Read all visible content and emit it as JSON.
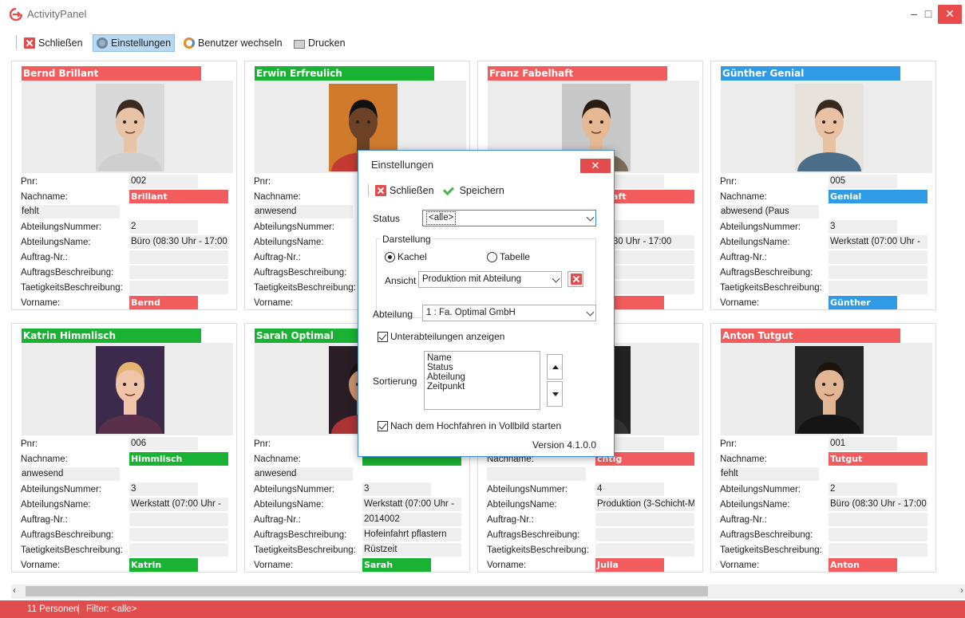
{
  "window": {
    "title": "ActivityPanel"
  },
  "toolbar": {
    "items": [
      {
        "label": "Schließen",
        "icon": "close-icon"
      },
      {
        "label": "Einstellungen",
        "icon": "gear-icon"
      },
      {
        "label": "Benutzer wechseln",
        "icon": "user-switch-icon"
      },
      {
        "label": "Drucken",
        "icon": "printer-icon"
      }
    ]
  },
  "field_labels": {
    "pnr": "Pnr:",
    "nachname": "Nachname:",
    "abt_nr": "AbteilungsNummer:",
    "abt_name": "AbteilungsName:",
    "auftrag": "Auftrag-Nr.:",
    "auftrag_beschr": "AuftragsBeschreibung:",
    "taetigkeit": "TaetigkeitsBeschreibung:",
    "vorname": "Vorname:"
  },
  "colors": {
    "red": "#f25c5c",
    "green": "#19b233",
    "blue": "#2f9be6"
  },
  "cards": [
    {
      "name": "Bernd Brillant",
      "color": "red",
      "pnr": "002",
      "nachname": "Brillant",
      "status": "fehlt",
      "abt_nr": "2",
      "abt_name": "Büro (08:30 Uhr - 17:00",
      "auftrag": "",
      "auftrag_beschr": "",
      "taetigkeit": "",
      "vorname": "Bernd"
    },
    {
      "name": "Erwin Erfreulich",
      "color": "green",
      "pnr": "",
      "nachname": "",
      "status": "anwesend",
      "abt_nr": "",
      "abt_name": "",
      "auftrag": "",
      "auftrag_beschr": "",
      "taetigkeit": "",
      "vorname": ""
    },
    {
      "name": "Franz Fabelhaft",
      "color": "red",
      "pnr": "",
      "nachname": "elhaft",
      "status": "",
      "abt_nr": "",
      "abt_name": "(08:30 Uhr - 17:00",
      "auftrag": "",
      "auftrag_beschr": "",
      "taetigkeit": "",
      "vorname": "z"
    },
    {
      "name": "Günther Genial",
      "color": "blue",
      "pnr": "005",
      "nachname": "Genial",
      "status": "abwesend (Paus",
      "abt_nr": "3",
      "abt_name": "Werkstatt (07:00 Uhr -",
      "auftrag": "",
      "auftrag_beschr": "",
      "taetigkeit": "",
      "vorname": "Günther"
    },
    {
      "name": "Katrin Himmlisch",
      "color": "green",
      "pnr": "006",
      "nachname": "Himmlisch",
      "status": "anwesend",
      "abt_nr": "3",
      "abt_name": "Werkstatt (07:00 Uhr -",
      "auftrag": "",
      "auftrag_beschr": "",
      "taetigkeit": "",
      "vorname": "Katrin"
    },
    {
      "name": "Sarah Optimal",
      "color": "green",
      "pnr": "",
      "nachname": "",
      "status": "anwesend",
      "abt_nr": "3",
      "abt_name": "Werkstatt (07:00 Uhr -",
      "auftrag": "2014002",
      "auftrag_beschr": "Hofeinfahrt pflastern",
      "taetigkeit": "Rüstzeit",
      "vorname": "Sarah"
    },
    {
      "name": "",
      "color": "red",
      "pnr": "",
      "nachname": "chtig",
      "status": "",
      "abt_nr": "4",
      "abt_name": "Produktion (3-Schicht-M",
      "auftrag": "",
      "auftrag_beschr": "",
      "taetigkeit": "",
      "vorname": "Julia"
    },
    {
      "name": "Anton Tutgut",
      "color": "red",
      "pnr": "001",
      "nachname": "Tutgut",
      "status": "fehlt",
      "abt_nr": "2",
      "abt_name": "Büro (08:30 Uhr - 17:00",
      "auftrag": "",
      "auftrag_beschr": "",
      "taetigkeit": "",
      "vorname": "Anton"
    }
  ],
  "dialog": {
    "title": "Einstellungen",
    "close_label": "✕",
    "schliessen": "Schließen",
    "speichern": "Speichern",
    "status_label": "Status",
    "status_value": "<alle>",
    "darstellung_label": "Darstellung",
    "kachel": "Kachel",
    "tabelle": "Tabelle",
    "ansicht_label": "Ansicht",
    "ansicht_value": "Produktion mit Abteilung",
    "abteilung_label": "Abteilung",
    "abteilung_value": "1 : Fa. Optimal GmbH",
    "unterabt": "Unterabteilungen anzeigen",
    "sortierung_label": "Sortierung",
    "sort_items": [
      "Name",
      "Status",
      "Abteilung",
      "Zeitpunkt"
    ],
    "vollbild": "Nach dem Hochfahren in Vollbild starten",
    "version": "Version 4.1.0.0"
  },
  "statusbar": {
    "count": "11 Personen",
    "filter": "Filter: <alle>"
  }
}
